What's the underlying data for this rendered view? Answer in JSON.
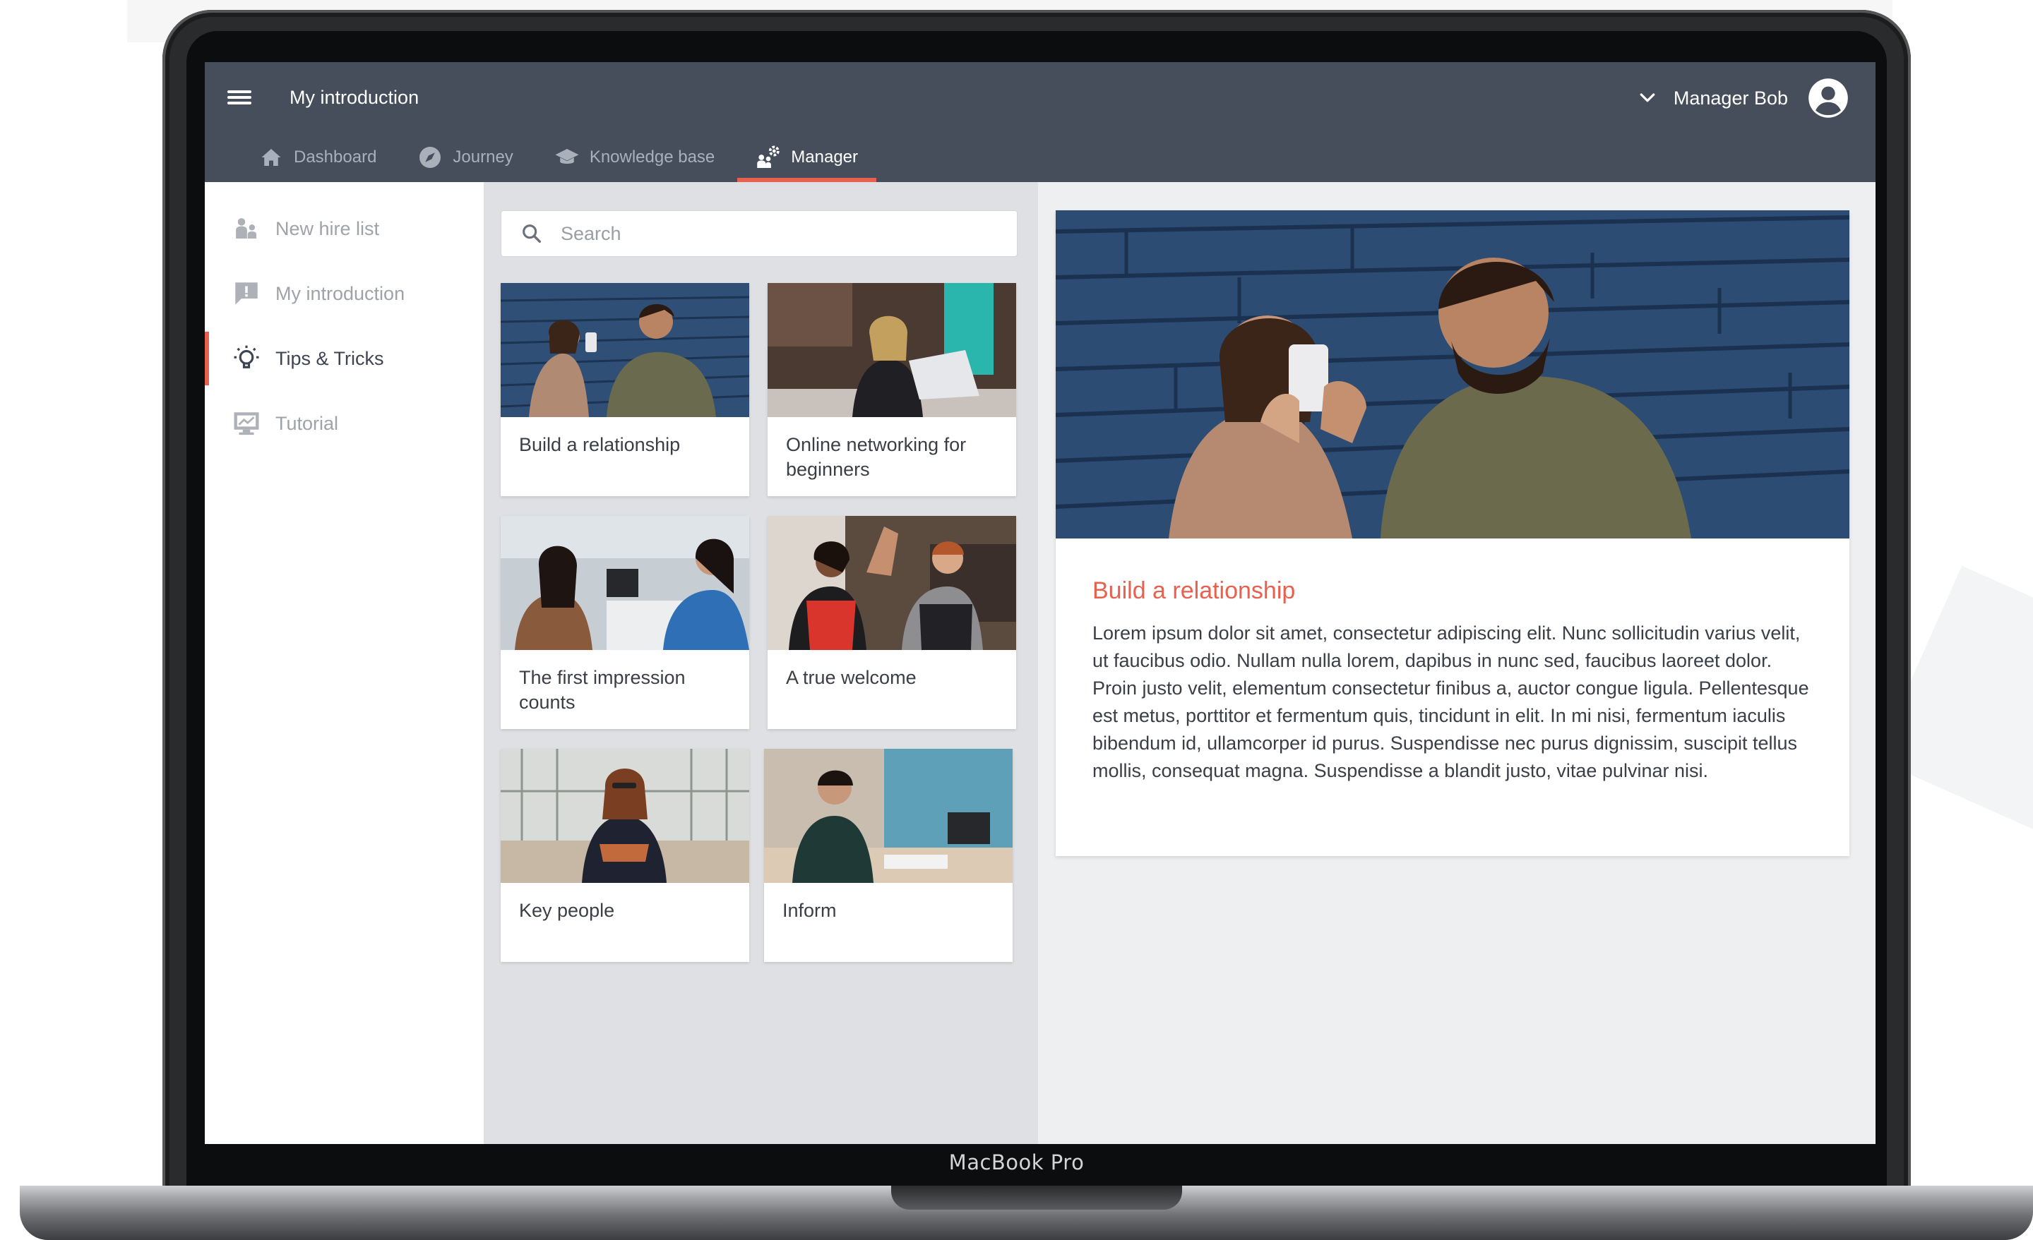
{
  "device": {
    "label": "MacBook Pro"
  },
  "header": {
    "menu_icon": "hamburger-menu-icon",
    "title": "My introduction",
    "user": {
      "name": "Manager Bob",
      "dropdown_icon": "chevron-down-icon",
      "avatar_icon": "user-avatar-icon"
    }
  },
  "nav": {
    "tabs": [
      {
        "label": "Dashboard",
        "icon": "home-icon",
        "active": false
      },
      {
        "label": "Journey",
        "icon": "compass-icon",
        "active": false
      },
      {
        "label": "Knowledge base",
        "icon": "graduation-cap-icon",
        "active": false
      },
      {
        "label": "Manager",
        "icon": "manager-gear-icon",
        "active": true
      }
    ],
    "accent_color": "#e8614f"
  },
  "sidebar": {
    "items": [
      {
        "label": "New hire list",
        "icon": "people-icon",
        "active": false
      },
      {
        "label": "My introduction",
        "icon": "message-alert-icon",
        "active": false
      },
      {
        "label": "Tips & Tricks",
        "icon": "lightbulb-icon",
        "active": true
      },
      {
        "label": "Tutorial",
        "icon": "presentation-icon",
        "active": false
      }
    ]
  },
  "search": {
    "placeholder": "Search",
    "value": "",
    "icon": "search-icon"
  },
  "cards": [
    {
      "title": "Build a relationship",
      "image": "two people taking a selfie against a blue brick wall"
    },
    {
      "title": "Online networking for beginners",
      "image": "woman at laptop in cafe"
    },
    {
      "title": "The first impression counts",
      "image": "two women talking at office desk"
    },
    {
      "title": "A true welcome",
      "image": "two people giving a high five in a cafe"
    },
    {
      "title": "Key people",
      "image": "woman with arms crossed in office"
    },
    {
      "title": "Inform",
      "image": "man writing notes at a table"
    }
  ],
  "detail": {
    "title": "Build a relationship",
    "body": "Lorem ipsum dolor sit amet, consectetur adipiscing elit. Nunc sollicitudin varius velit, ut faucibus odio. Nullam nulla lorem, dapibus in nunc sed, faucibus laoreet dolor. Proin justo velit, elementum consectetur finibus a, auctor congue ligula. Pellentesque est metus, porttitor et fermentum quis, tincidunt in elit. In mi nisi, fermentum iaculis bibendum id, ullamcorper id purus. Suspendisse nec purus dignissim, suscipit tellus mollis, consequat magna. Suspendisse a blandit justo, vitae pulvinar nisi.",
    "title_color": "#e8614f"
  }
}
